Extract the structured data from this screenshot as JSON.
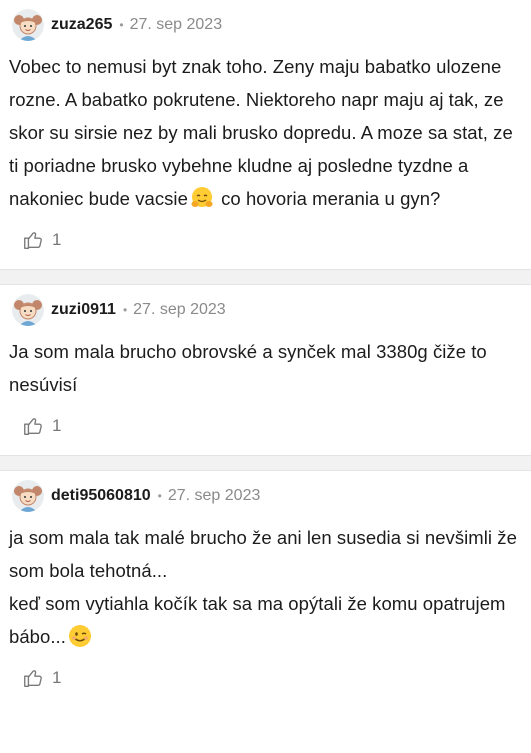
{
  "comments": [
    {
      "author": "zuza265",
      "date": "27. sep 2023",
      "text_before_emoji": "Vobec to nemusi byt znak toho. Zeny maju babatko ulozene rozne. A babatko pokrutene. Niektoreho napr maju aj tak, ze skor su sirsie nez by mali brusko dopredu. A moze sa stat, ze ti poriadne brusko vybehne kludne aj posledne tyzdne a nakoniec bude vacsie",
      "emoji": "hugging-face",
      "text_after_emoji": " co hovoria merania u gyn?",
      "likes": "1"
    },
    {
      "author": "zuzi0911",
      "date": "27. sep 2023",
      "text": "Ja som mala brucho obrovské a synček mal 3380g čiže to nesúvisí",
      "likes": "1"
    },
    {
      "author": "deti95060810",
      "date": "27. sep 2023",
      "line1": "ja som mala tak malé brucho že ani len susedia si nevšimli že som bola tehotná...",
      "line2_before_emoji": "keď som vytiahla kočík tak sa ma opýtali že komu opatrujem bábo...",
      "emoji": "winking-face",
      "likes": "1"
    }
  ],
  "meta_separator": "•"
}
